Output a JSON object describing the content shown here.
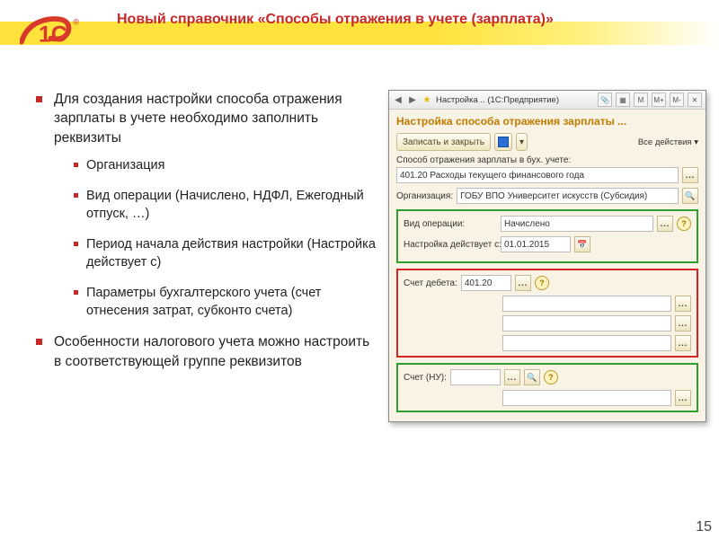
{
  "slide": {
    "title": "Новый справочник «Способы отражения в учете (зарплата)»",
    "page_number": "15",
    "bullets": [
      "Для создания настройки способа отражения зарплаты в учете необходимо заполнить реквизиты",
      "Особенности налогового учета можно настроить в соответствующей группе реквизитов"
    ],
    "sub_bullets": [
      "Организация",
      "Вид операции (Начислено, НДФЛ, Ежегодный отпуск, …)",
      "Период начала действия настройки (Настройка действует с)",
      "Параметры бухгалтерского учета (счет отнесения затрат, субконто счета)"
    ]
  },
  "app": {
    "window_title": "Настройка .. (1С:Предприятие)",
    "form_title": "Настройка способа отражения зарплаты ...",
    "toolbar": {
      "save_close": "Записать и закрыть",
      "all_actions": "Все действия",
      "dropdown_glyph": "▾"
    },
    "labels": {
      "method": "Способ отражения зарплаты в бух. учете:",
      "org": "Организация:",
      "op_type": "Вид операции:",
      "effective_from": "Настройка действует с:",
      "debit_account": "Счет дебета:",
      "tax_account": "Счет (НУ):"
    },
    "values": {
      "method": "401.20 Расходы текущего финансового года",
      "org": "ГОБУ ВПО Университет искусств (Субсидия)",
      "op_type": "Начислено",
      "effective_from": "01.01.2015",
      "debit_account": "401.20",
      "tax_account": ""
    },
    "glyphs": {
      "ellipsis": "...",
      "search": "🔍",
      "calendar": "📅",
      "help": "?"
    }
  }
}
